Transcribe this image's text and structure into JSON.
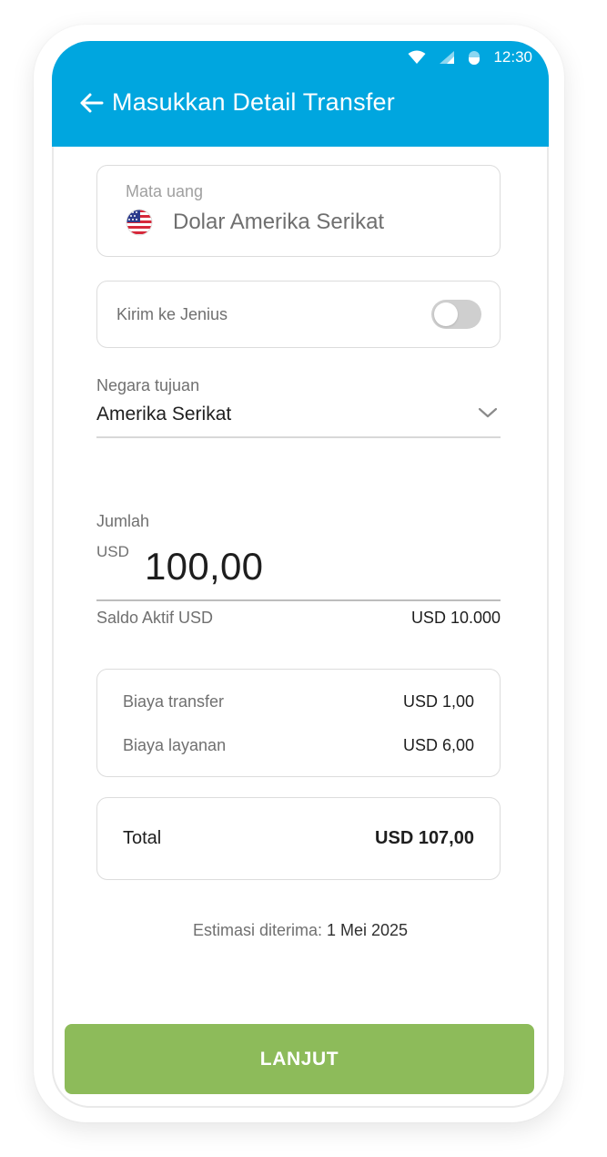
{
  "status_bar": {
    "time": "12:30",
    "icons": [
      "wifi-icon",
      "signal-icon",
      "battery-icon"
    ]
  },
  "header": {
    "title": "Masukkan Detail Transfer",
    "back_icon": "arrow-left-icon"
  },
  "currency": {
    "label": "Mata uang",
    "value": "Dolar Amerika Serikat",
    "flag_icon": "us-flag-icon"
  },
  "send_to_jenius": {
    "label": "Kirim ke Jenius",
    "enabled": false
  },
  "destination_country": {
    "label": "Negara tujuan",
    "value": "Amerika Serikat",
    "dropdown_icon": "chevron-down-icon"
  },
  "amount": {
    "label": "Jumlah",
    "currency": "USD",
    "value": "100,00",
    "balance_label": "Saldo Aktif USD",
    "balance_value": "USD 10.000"
  },
  "fees": [
    {
      "label": "Biaya transfer",
      "value": "USD 1,00"
    },
    {
      "label": "Biaya layanan",
      "value": "USD 6,00"
    }
  ],
  "total": {
    "label": "Total",
    "value": "USD 107,00"
  },
  "estimate": {
    "label": "Estimasi diterima:",
    "value": "1 Mei 2025"
  },
  "cta": {
    "label": "LANJUT"
  },
  "colors": {
    "header": "#00a6df",
    "button": "#8dbb5a",
    "toggle_off": "#cfcfcf"
  }
}
